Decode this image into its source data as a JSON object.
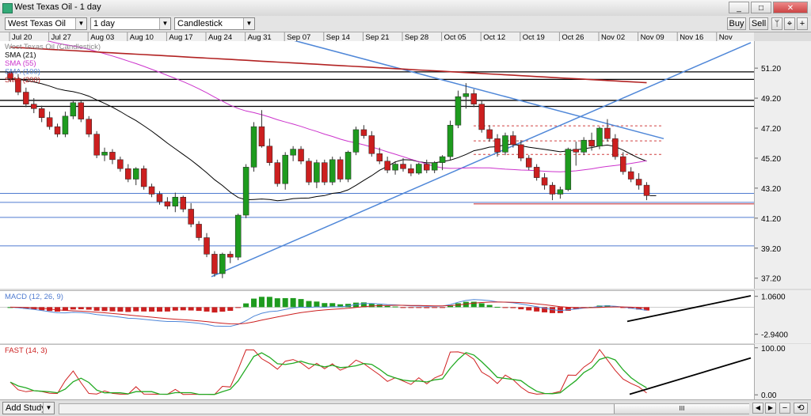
{
  "window": {
    "title": "West Texas Oil - 1 day",
    "minimize": "_",
    "maximize": "□",
    "close": "✕"
  },
  "toolbar": {
    "instrument": "West Texas Oil",
    "timeframe": "1 day",
    "chart_type": "Candlestick",
    "buy_label": "Buy",
    "sell_label": "Sell"
  },
  "status": {
    "add_study": "Add Study",
    "scroll_grip": "III"
  },
  "colors": {
    "up": "#1e9b1e",
    "down": "#cc1f1f",
    "sma21": "#000000",
    "sma55": "#cc33cc",
    "sma100": "#5b86d6",
    "sma200": "#b22222",
    "trend": "#4f87d8"
  },
  "icons": [
    "chart-settings-icon",
    "crosshair-icon",
    "zoom-in-icon",
    "zoom-out-icon",
    "reset-icon",
    "scroll-left-icon",
    "scroll-right-icon"
  ],
  "chart_data": [
    {
      "type": "candlestick",
      "instrument": "West Texas Oil",
      "legend": [
        "West Texas Oil (Candlestick)",
        "SMA (21)",
        "SMA (55)",
        "SMA (100)",
        "SMA (200)"
      ],
      "x_ticks": [
        "Jul 20",
        "Jul 27",
        "Aug 03",
        "Aug 10",
        "Aug 17",
        "Aug 24",
        "Aug 31",
        "Sep 07",
        "Sep 14",
        "Sep 21",
        "Sep 28",
        "Oct 05",
        "Oct 12",
        "Oct 19",
        "Oct 26",
        "Nov 02",
        "Nov 09",
        "Nov 16",
        "Nov"
      ],
      "y_ticks": [
        51.2,
        49.2,
        47.2,
        45.2,
        43.2,
        41.2,
        39.2,
        37.2
      ],
      "ylim": [
        36.5,
        53.0
      ],
      "candles": [
        [
          50.9,
          51.0,
          50.3,
          50.5
        ],
        [
          50.5,
          50.8,
          49.4,
          49.6
        ],
        [
          49.6,
          49.9,
          48.6,
          48.8
        ],
        [
          48.8,
          49.2,
          48.2,
          48.5
        ],
        [
          48.5,
          48.7,
          47.6,
          47.9
        ],
        [
          47.9,
          48.3,
          47.1,
          47.3
        ],
        [
          47.3,
          47.5,
          46.6,
          46.8
        ],
        [
          46.8,
          48.3,
          46.6,
          48.0
        ],
        [
          48.0,
          49.0,
          47.8,
          48.9
        ],
        [
          48.9,
          49.1,
          47.6,
          47.8
        ],
        [
          47.8,
          48.0,
          46.6,
          46.8
        ],
        [
          46.8,
          47.0,
          45.2,
          45.4
        ],
        [
          45.4,
          45.9,
          45.0,
          45.6
        ],
        [
          45.6,
          45.8,
          44.8,
          45.1
        ],
        [
          45.1,
          45.3,
          44.3,
          44.5
        ],
        [
          44.5,
          44.8,
          43.6,
          43.8
        ],
        [
          43.8,
          44.6,
          43.4,
          44.5
        ],
        [
          44.5,
          44.7,
          43.1,
          43.3
        ],
        [
          43.3,
          43.5,
          42.6,
          42.8
        ],
        [
          42.8,
          43.0,
          42.1,
          42.3
        ],
        [
          42.3,
          42.6,
          41.8,
          42.0
        ],
        [
          42.0,
          42.9,
          41.6,
          42.6
        ],
        [
          42.6,
          42.7,
          41.6,
          41.8
        ],
        [
          41.8,
          42.2,
          40.6,
          40.8
        ],
        [
          40.8,
          41.0,
          39.7,
          39.9
        ],
        [
          39.9,
          40.2,
          38.6,
          38.8
        ],
        [
          38.8,
          39.0,
          37.3,
          37.5
        ],
        [
          37.5,
          38.9,
          37.2,
          38.8
        ],
        [
          38.8,
          39.0,
          38.2,
          38.6
        ],
        [
          38.6,
          41.5,
          38.4,
          41.4
        ],
        [
          41.4,
          44.8,
          41.2,
          44.6
        ],
        [
          44.6,
          47.6,
          44.3,
          47.3
        ],
        [
          47.3,
          48.4,
          45.9,
          46.0
        ],
        [
          46.0,
          46.5,
          44.7,
          44.9
        ],
        [
          44.9,
          45.1,
          43.3,
          43.5
        ],
        [
          43.5,
          45.6,
          43.1,
          45.4
        ],
        [
          45.4,
          46.0,
          45.0,
          45.8
        ],
        [
          45.8,
          46.0,
          44.8,
          45.0
        ],
        [
          45.0,
          45.2,
          43.4,
          43.6
        ],
        [
          43.6,
          45.1,
          43.2,
          44.9
        ],
        [
          44.9,
          45.1,
          43.4,
          43.6
        ],
        [
          43.6,
          45.3,
          43.4,
          45.1
        ],
        [
          45.1,
          45.3,
          43.6,
          43.8
        ],
        [
          43.8,
          45.7,
          43.6,
          45.6
        ],
        [
          45.6,
          47.3,
          45.4,
          47.1
        ],
        [
          47.1,
          47.4,
          46.5,
          46.7
        ],
        [
          46.7,
          47.0,
          45.3,
          45.5
        ],
        [
          45.5,
          45.9,
          44.8,
          45.0
        ],
        [
          45.0,
          45.3,
          44.2,
          44.4
        ],
        [
          44.4,
          45.0,
          44.1,
          44.8
        ],
        [
          44.8,
          45.2,
          44.3,
          44.5
        ],
        [
          44.5,
          44.8,
          44.0,
          44.2
        ],
        [
          44.2,
          44.9,
          44.1,
          44.8
        ],
        [
          44.8,
          45.1,
          44.2,
          44.4
        ],
        [
          44.4,
          45.0,
          44.2,
          44.9
        ],
        [
          44.9,
          45.4,
          44.4,
          45.3
        ],
        [
          45.3,
          47.7,
          45.1,
          47.4
        ],
        [
          47.4,
          49.7,
          47.2,
          49.3
        ],
        [
          49.3,
          50.2,
          48.5,
          49.5
        ],
        [
          49.5,
          49.8,
          48.6,
          48.8
        ],
        [
          48.8,
          49.0,
          46.9,
          47.1
        ],
        [
          47.1,
          47.4,
          46.3,
          46.5
        ],
        [
          46.5,
          46.8,
          45.3,
          45.6
        ],
        [
          45.6,
          46.9,
          45.4,
          46.7
        ],
        [
          46.7,
          47.0,
          45.9,
          46.1
        ],
        [
          46.1,
          46.4,
          45.0,
          45.2
        ],
        [
          45.2,
          45.4,
          44.4,
          44.6
        ],
        [
          44.6,
          44.8,
          43.7,
          43.9
        ],
        [
          43.9,
          44.2,
          43.1,
          43.4
        ],
        [
          43.4,
          43.6,
          42.4,
          42.8
        ],
        [
          42.8,
          43.3,
          42.5,
          43.1
        ],
        [
          43.1,
          45.9,
          43.0,
          45.8
        ],
        [
          45.8,
          46.3,
          44.7,
          45.6
        ],
        [
          45.6,
          46.6,
          45.4,
          46.4
        ],
        [
          46.4,
          46.9,
          45.7,
          46.0
        ],
        [
          46.0,
          47.3,
          45.8,
          47.2
        ],
        [
          47.2,
          47.8,
          46.3,
          46.5
        ],
        [
          46.5,
          46.8,
          45.1,
          45.3
        ],
        [
          45.3,
          45.6,
          44.1,
          44.3
        ],
        [
          44.3,
          44.6,
          43.6,
          43.8
        ],
        [
          43.8,
          44.2,
          43.1,
          43.4
        ],
        [
          43.4,
          43.6,
          42.4,
          42.7
        ]
      ],
      "horizontal_levels": [
        50.95,
        50.45,
        49.05,
        48.65,
        42.85,
        42.25,
        41.25,
        39.35
      ],
      "dashed_levels": [
        47.35,
        46.35,
        45.45
      ],
      "red_support": 42.15,
      "current_price": 42.7
    },
    {
      "type": "bar",
      "name": "MACD (12, 26, 9)",
      "y_ticks": [
        1.06,
        -2.94
      ],
      "ylim": [
        -3.8,
        1.7
      ]
    },
    {
      "type": "line",
      "name": "FAST (14, 3)",
      "y_ticks": [
        100.0,
        0.0
      ],
      "ylim": [
        -8,
        108
      ]
    }
  ]
}
